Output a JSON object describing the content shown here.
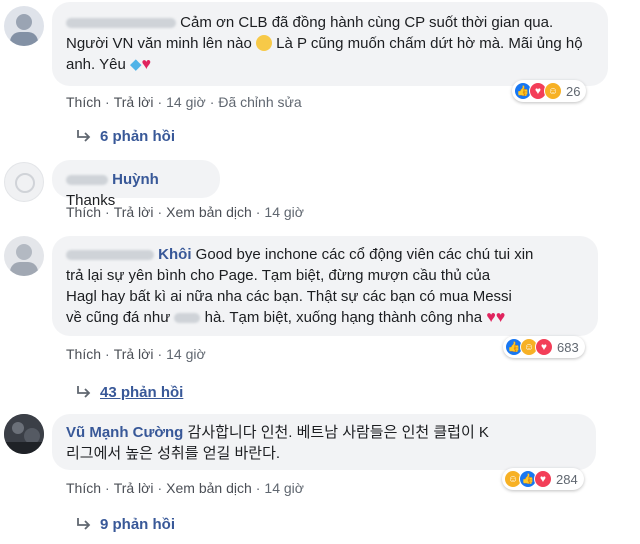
{
  "comments": [
    {
      "name": "",
      "text": "Cảm ơn CLB đã đồng hành cùng CP suốt thời gian qua. Người VN văn minh lên nào",
      "text_after_emoji": "Là P cũng muốn chấm dứt hờ mà. Mãi ủng hộ anh. Yêu",
      "actions": {
        "like": "Thích",
        "reply": "Trả lời",
        "time": "14 giờ",
        "edited": "Đã chỉnh sửa"
      },
      "reactions": {
        "icons": [
          "like-icon",
          "love-icon",
          "haha-icon"
        ],
        "count": "26"
      },
      "replies": "6 phản hồi"
    },
    {
      "name": "Huỳnh",
      "text": "Thanks",
      "actions": {
        "like": "Thích",
        "reply": "Trả lời",
        "translate": "Xem bản dịch",
        "time": "14 giờ"
      }
    },
    {
      "name": "Khôi",
      "text_line1": "Good bye inchone các cổ động viên các chú tui xin",
      "text_line2": "trả lại sự yên bình cho Page. Tạm biệt, đừng mượn cầu thủ của",
      "text_line3": "Hagl hay bất kì ai nữa nha các bạn. Thật sự các bạn có mua Messi",
      "text_line4a": "về cũng đá như",
      "text_line4b": "hà. Tạm biệt, xuống hạng thành công nha",
      "actions": {
        "like": "Thích",
        "reply": "Trả lời",
        "time": "14 giờ"
      },
      "reactions": {
        "icons": [
          "like-icon",
          "haha-icon",
          "love-icon"
        ],
        "count": "683"
      },
      "replies": "43 phản hồi"
    },
    {
      "name": "Vũ Mạnh Cường",
      "text_line1": "감사합니다 인천. 베트남 사람들은 인천 클럽이 K",
      "text_line2": "리그에서 높은 성취를 얻길 바란다.",
      "actions": {
        "like": "Thích",
        "reply": "Trả lời",
        "translate": "Xem bản dịch",
        "time": "14 giờ"
      },
      "reactions": {
        "icons": [
          "haha-icon",
          "like-icon",
          "love-icon"
        ],
        "count": "284"
      },
      "replies": "9 phản hồi"
    }
  ],
  "colors": {
    "like": "#1877f2",
    "love": "#f33e58",
    "haha": "#f7b125",
    "link": "#385898",
    "bubble": "#f2f3f5"
  }
}
